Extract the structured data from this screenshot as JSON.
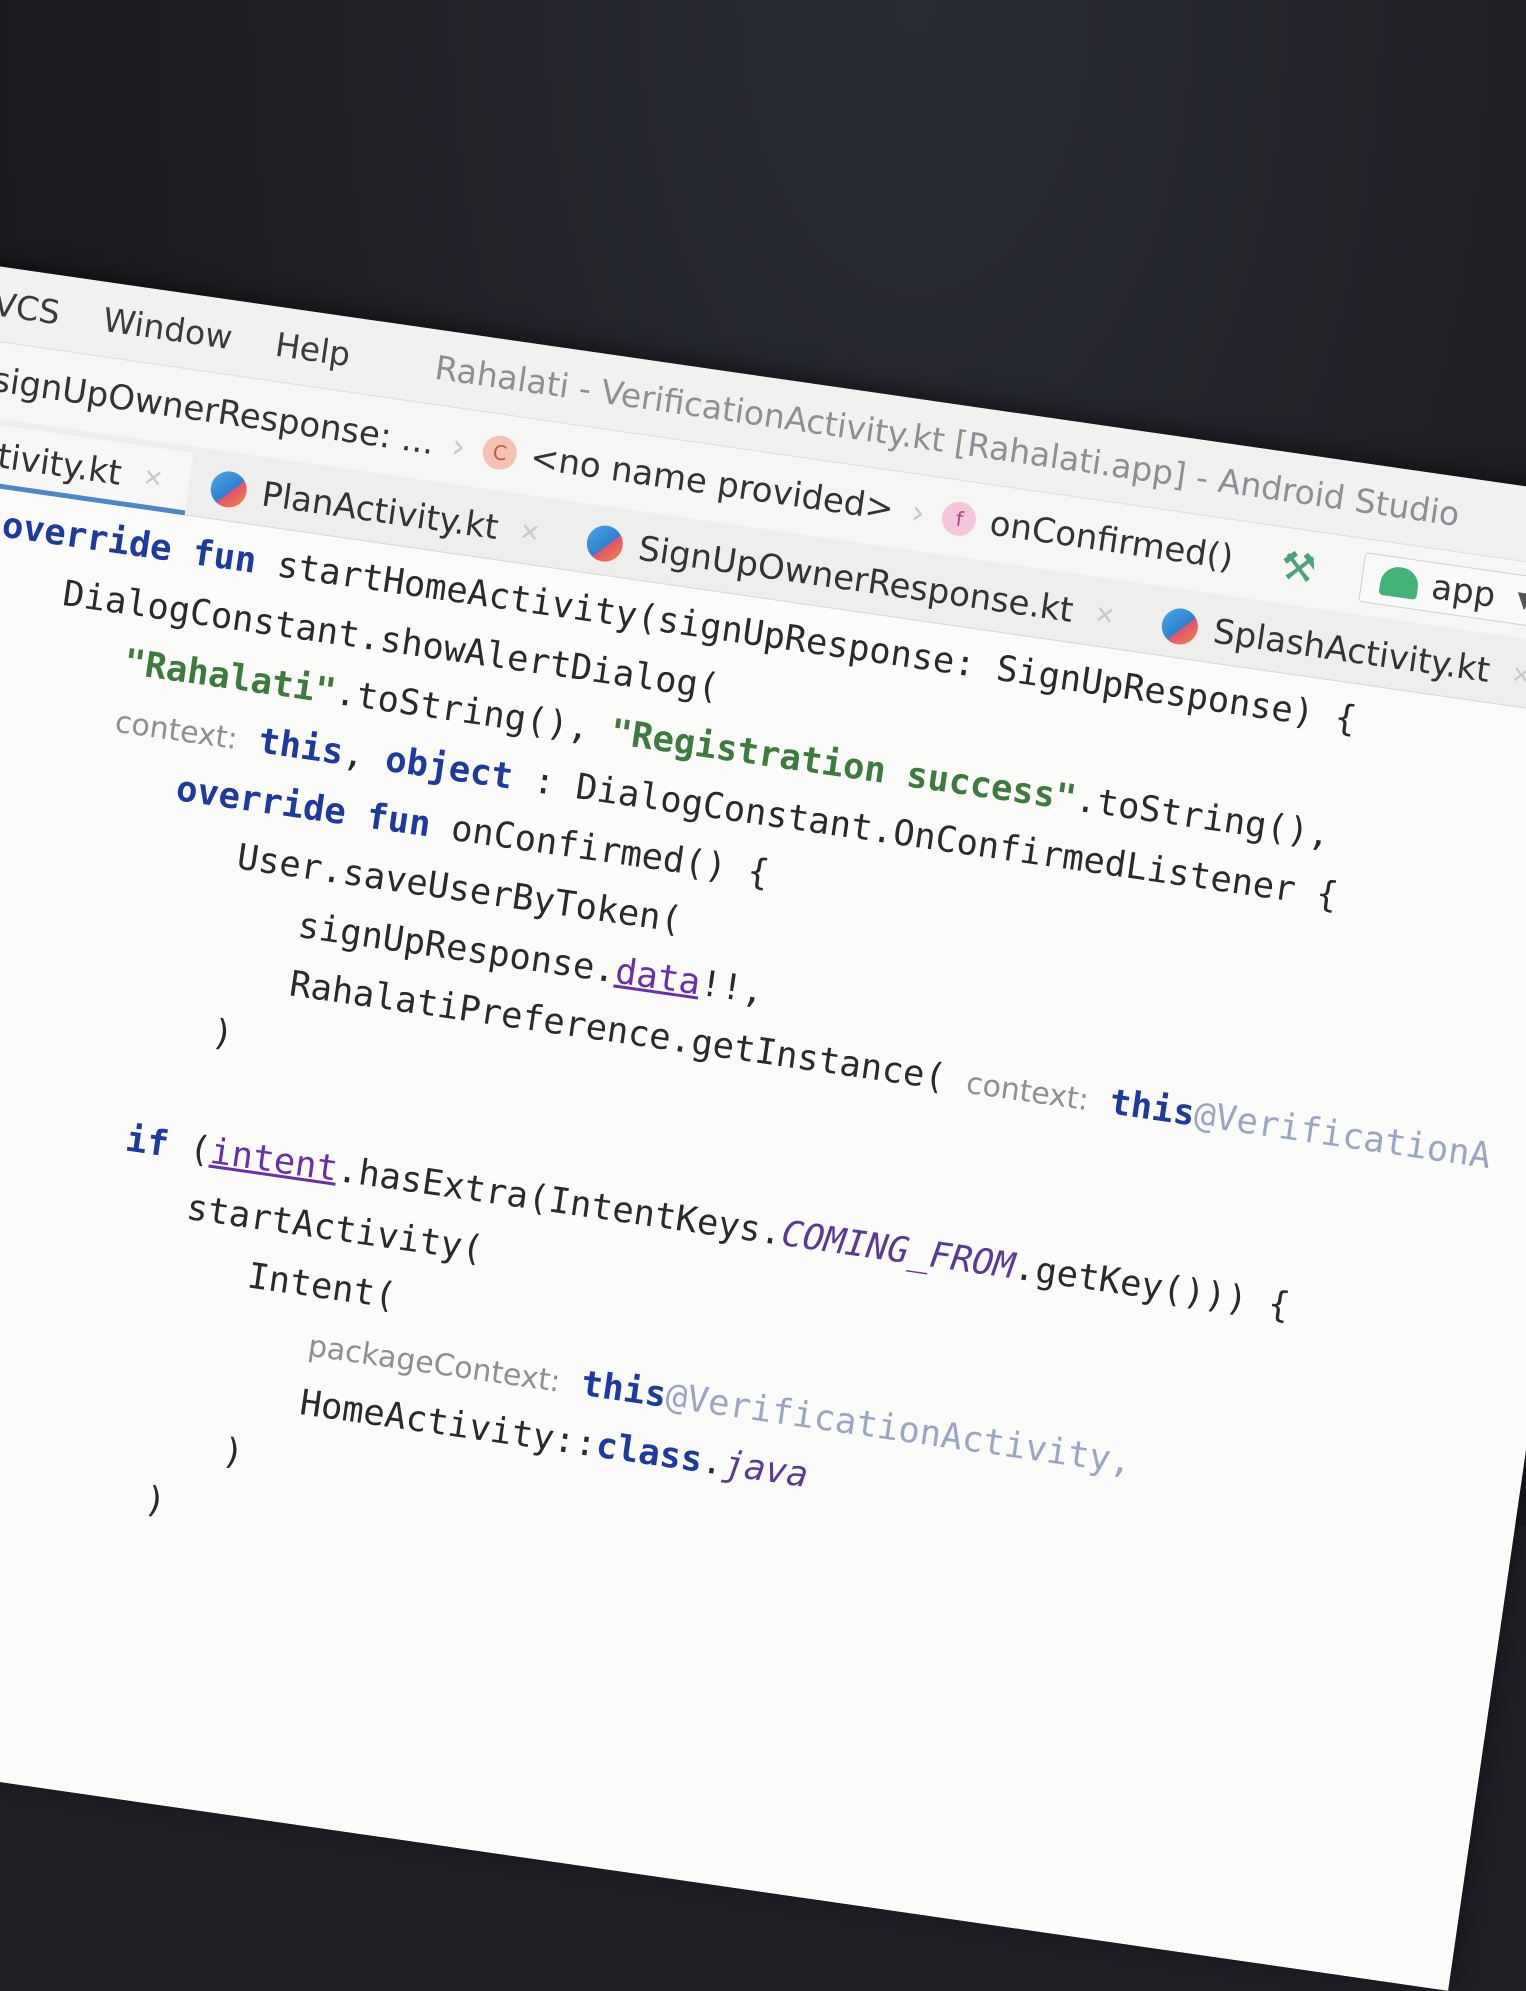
{
  "menu": {
    "items": [
      {
        "label": "VCS"
      },
      {
        "label": "Window"
      },
      {
        "label": "Help"
      }
    ],
    "window_title": "Rahalati - VerificationActivity.kt [Rahalati.app] - Android Studio"
  },
  "breadcrumb": {
    "items": [
      {
        "label": "vner(signUpOwnerResponse: ...",
        "icon": "none"
      },
      {
        "label": "<no name provided>",
        "icon": "class-icon"
      },
      {
        "label": "onConfirmed()",
        "icon": "function-icon"
      }
    ],
    "icon_glyphs": {
      "class": "C",
      "function": "f"
    },
    "run_config": "app",
    "build_icon": "hammer-icon"
  },
  "tabs": [
    {
      "label": "onActivity.kt",
      "active": true
    },
    {
      "label": "PlanActivity.kt",
      "active": false
    },
    {
      "label": "SignUpOwnerResponse.kt",
      "active": false
    },
    {
      "label": "SplashActivity.kt",
      "active": false
    }
  ],
  "code": {
    "l1": {
      "a": "override fun ",
      "b": "startHomeActivity(signUpResponse: SignUpResponse) {"
    },
    "l2": {
      "a": "DialogConstant.showAlertDialog("
    },
    "l3": {
      "a": "\"Rahalati\"",
      "b": ".toString(), ",
      "c": "\"Registration success\"",
      "d": ".toString(),"
    },
    "l4": {
      "hint": "context:",
      "a": " this",
      "b": ", ",
      "c": "object",
      "d": " : DialogConstant.OnConfirmedListener {"
    },
    "l5": {
      "a": "override fun ",
      "b": "onConfirmed() {"
    },
    "l6": {
      "a": "User.saveUserByToken("
    },
    "l7": {
      "a": "signUpResponse.",
      "b": "data",
      "c": "!!,"
    },
    "l8": {
      "a": "RahalatiPreference.getInstance( ",
      "hint": "context:",
      "b": " this",
      "c": "@VerificationA"
    },
    "l9": {
      "a": ")"
    },
    "l11": {
      "a": "if",
      "b": " (",
      "c": "intent",
      "d": ".hasExtra(IntentKeys.",
      "e": "COMING_FROM",
      "f": ".getKey())) {"
    },
    "l12": {
      "a": "startActivity("
    },
    "l13": {
      "a": "Intent("
    },
    "l14": {
      "hint": "packageContext:",
      "a": " this",
      "b": "@VerificationActivity,"
    },
    "l15": {
      "a": "HomeActivity::",
      "b": "class",
      "c": ".",
      "d": "java"
    },
    "l16": {
      "a": ")"
    },
    "l17": {
      "a": ")"
    }
  },
  "colors": {
    "keyword": "#1e3a9e",
    "string": "#3d7a3d",
    "constant": "#5b3a96",
    "hint": "#8f8f8f",
    "active_tab_underline": "#4a86c8"
  }
}
